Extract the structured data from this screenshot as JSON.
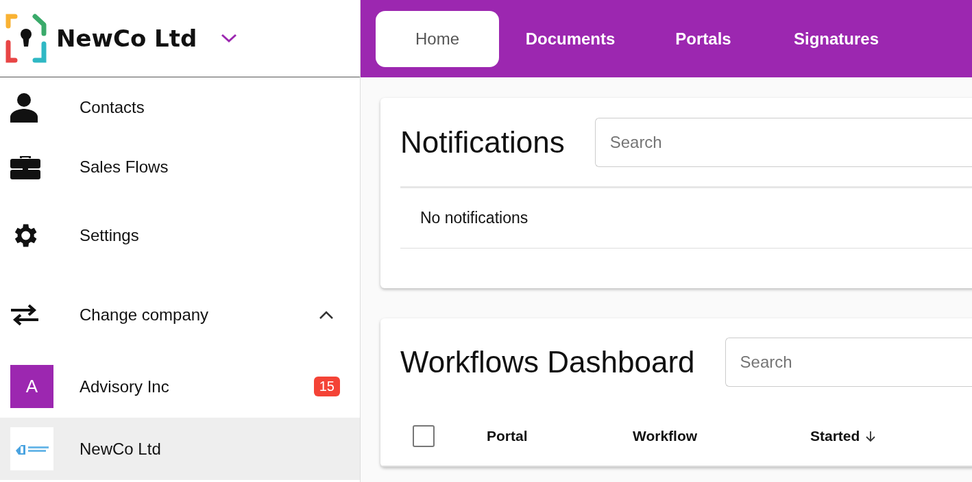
{
  "company_switcher": {
    "name": "NewCo Ltd",
    "expanded": false
  },
  "nav_tabs": [
    {
      "label": "Home",
      "selected": true
    },
    {
      "label": "Documents",
      "selected": false
    },
    {
      "label": "Portals",
      "selected": false
    },
    {
      "label": "Signatures",
      "selected": false
    }
  ],
  "sidebar": {
    "items": [
      {
        "label": "Contacts"
      },
      {
        "label": "Sales Flows"
      },
      {
        "label": "Settings"
      }
    ],
    "change_company": {
      "label": "Change company",
      "expanded": true,
      "companies": [
        {
          "name": "Advisory Inc",
          "kind": "letter",
          "avatar": "A",
          "badge": "15",
          "selected": false
        },
        {
          "name": "NewCo Ltd",
          "kind": "logo",
          "selected": true
        }
      ]
    }
  },
  "notifications": {
    "title": "Notifications",
    "search": {
      "placeholder": "Search"
    },
    "empty_text": "No notifications"
  },
  "workflows": {
    "title": "Workflows Dashboard",
    "search": {
      "placeholder": "Search"
    },
    "select_all": {
      "checked": false
    },
    "columns": [
      {
        "label": "Portal",
        "sorted": false
      },
      {
        "label": "Workflow",
        "sorted": false
      },
      {
        "label": "Started",
        "sorted": true
      }
    ]
  }
}
